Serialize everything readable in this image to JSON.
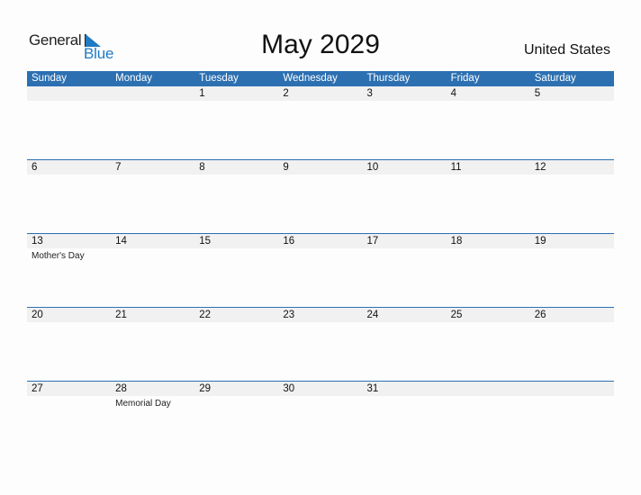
{
  "logo": {
    "word1": "General",
    "word2": "Blue",
    "accent_color": "#1f7bc4"
  },
  "title": "May 2029",
  "country": "United States",
  "header_color": "#2c70b2",
  "weekdays": [
    "Sunday",
    "Monday",
    "Tuesday",
    "Wednesday",
    "Thursday",
    "Friday",
    "Saturday"
  ],
  "weeks": [
    {
      "days": [
        {
          "n": "",
          "h": ""
        },
        {
          "n": "",
          "h": ""
        },
        {
          "n": "1",
          "h": ""
        },
        {
          "n": "2",
          "h": ""
        },
        {
          "n": "3",
          "h": ""
        },
        {
          "n": "4",
          "h": ""
        },
        {
          "n": "5",
          "h": ""
        }
      ]
    },
    {
      "days": [
        {
          "n": "6",
          "h": ""
        },
        {
          "n": "7",
          "h": ""
        },
        {
          "n": "8",
          "h": ""
        },
        {
          "n": "9",
          "h": ""
        },
        {
          "n": "10",
          "h": ""
        },
        {
          "n": "11",
          "h": ""
        },
        {
          "n": "12",
          "h": ""
        }
      ]
    },
    {
      "days": [
        {
          "n": "13",
          "h": "Mother's Day"
        },
        {
          "n": "14",
          "h": ""
        },
        {
          "n": "15",
          "h": ""
        },
        {
          "n": "16",
          "h": ""
        },
        {
          "n": "17",
          "h": ""
        },
        {
          "n": "18",
          "h": ""
        },
        {
          "n": "19",
          "h": ""
        }
      ]
    },
    {
      "days": [
        {
          "n": "20",
          "h": ""
        },
        {
          "n": "21",
          "h": ""
        },
        {
          "n": "22",
          "h": ""
        },
        {
          "n": "23",
          "h": ""
        },
        {
          "n": "24",
          "h": ""
        },
        {
          "n": "25",
          "h": ""
        },
        {
          "n": "26",
          "h": ""
        }
      ]
    },
    {
      "days": [
        {
          "n": "27",
          "h": ""
        },
        {
          "n": "28",
          "h": "Memorial Day"
        },
        {
          "n": "29",
          "h": ""
        },
        {
          "n": "30",
          "h": ""
        },
        {
          "n": "31",
          "h": ""
        },
        {
          "n": "",
          "h": ""
        },
        {
          "n": "",
          "h": ""
        }
      ]
    }
  ]
}
